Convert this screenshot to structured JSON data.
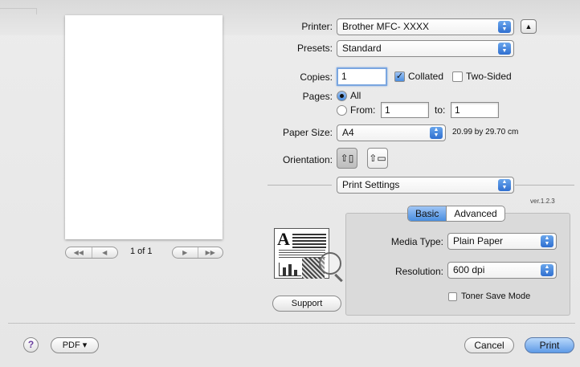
{
  "printer": {
    "label": "Printer:",
    "value": "Brother MFC- XXXX"
  },
  "presets": {
    "label": "Presets:",
    "value": "Standard"
  },
  "copies": {
    "label": "Copies:",
    "value": "1",
    "collated_label": "Collated",
    "collated_checked": true,
    "two_sided_label": "Two-Sided",
    "two_sided_checked": false
  },
  "pages": {
    "label": "Pages:",
    "all_label": "All",
    "from_label": "From:",
    "from_value": "1",
    "to_label": "to:",
    "to_value": "1"
  },
  "paper_size": {
    "label": "Paper Size:",
    "value": "A4",
    "dimensions": "20.99 by 29.70 cm"
  },
  "orientation": {
    "label": "Orientation:",
    "portrait_icon": "portrait-orientation-icon",
    "landscape_icon": "landscape-orientation-icon"
  },
  "section_popup": {
    "value": "Print Settings"
  },
  "version": "ver.1.2.3",
  "tabs": [
    {
      "label": "Basic",
      "selected": true
    },
    {
      "label": "Advanced",
      "selected": false
    }
  ],
  "media_type": {
    "label": "Media Type:",
    "value": "Plain Paper"
  },
  "resolution": {
    "label": "Resolution:",
    "value": "600 dpi"
  },
  "toner_save": {
    "label": "Toner Save Mode",
    "checked": false
  },
  "support_button": "Support",
  "preview_nav": {
    "page_indicator": "1 of 1"
  },
  "footer": {
    "help": "?",
    "pdf_button": "PDF ▾",
    "cancel_button": "Cancel",
    "print_button": "Print"
  },
  "colors": {
    "accent": "#4a8ee0",
    "default_button": "#5e9ae6"
  }
}
